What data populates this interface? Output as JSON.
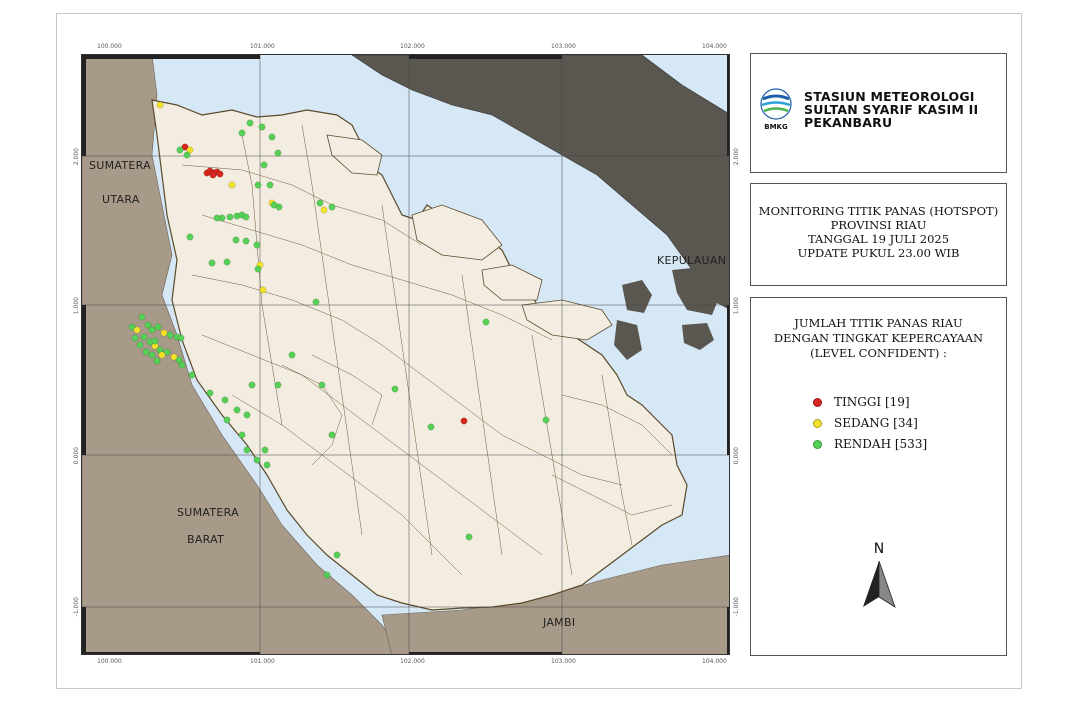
{
  "map": {
    "region_labels": {
      "sumatera_utara_1": "SUMATERA",
      "sumatera_utara_2": "UTARA",
      "sumatera_barat_1": "SUMATERA",
      "sumatera_barat_2": "BARAT",
      "kepulauan": "KEPULAUAN",
      "jambi": "JAMBI"
    },
    "ticks_top": [
      "100.000",
      "101.000",
      "102.000",
      "103.000",
      "104.000"
    ],
    "ticks_bottom": [
      "100.000",
      "101.000",
      "102.000",
      "103.000",
      "104.000"
    ],
    "ticks_left": [
      "2.000",
      "1.000",
      "0.000",
      "-1.000"
    ],
    "ticks_right": [
      "2.000",
      "1.000",
      "0.000",
      "-1.000"
    ],
    "colors": {
      "sea": "#d6e8f5",
      "land_outside": "#a89a88",
      "land_riau": "#f3ede1",
      "boundary": "#5b4a2a",
      "dark_island": "#5a5650",
      "tinggi": "#d8261e",
      "sedang": "#f3e22a",
      "rendah": "#55d155"
    }
  },
  "header": {
    "org_line1": "STASIUN METEOROLOGI",
    "org_line2": "SULTAN SYARIF KASIM II",
    "org_line3": "PEKANBARU",
    "logo_text": "BMKG"
  },
  "title": {
    "line1": "MONITORING TITIK PANAS (HOTSPOT)",
    "line2": "PROVINSI RIAU",
    "line3": "TANGGAL 19 JULI 2025",
    "line4": "UPDATE PUKUL 23.00 WIB"
  },
  "legend": {
    "title_line1": "JUMLAH TITIK PANAS RIAU",
    "title_line2": "DENGAN TINGKAT KEPERCAYAAN",
    "title_line3": "(LEVEL CONFIDENT) :",
    "items": [
      {
        "label": "TINGGI [19]",
        "color": "#d8261e",
        "count": 19
      },
      {
        "label": "SEDANG [34]",
        "color": "#f3e22a",
        "count": 34
      },
      {
        "label": "RENDAH [533]",
        "color": "#55d155",
        "count": 533
      }
    ]
  },
  "north_arrow": {
    "letter": "N"
  }
}
